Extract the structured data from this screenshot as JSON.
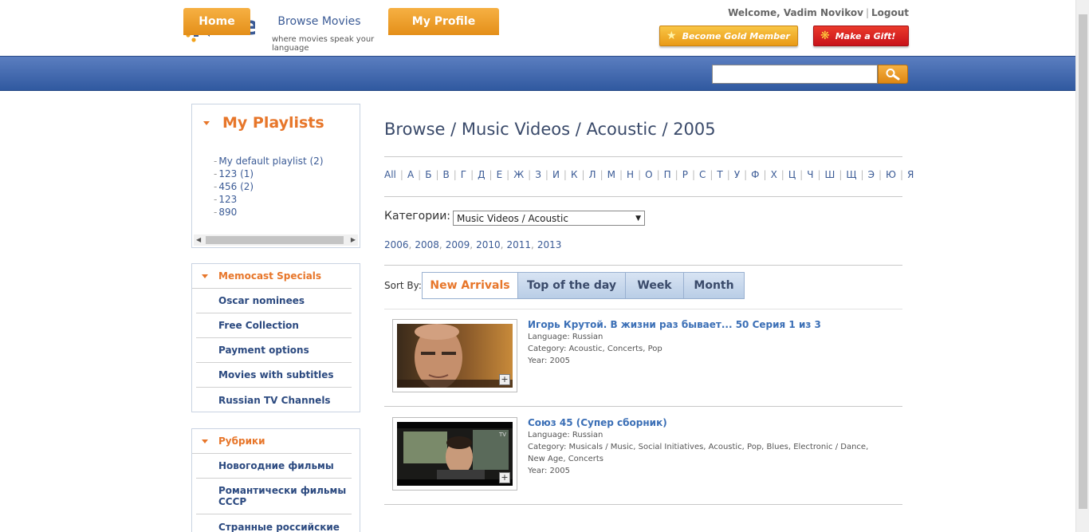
{
  "header": {
    "logo_text": "memocast",
    "tagline": "where movies speak your language",
    "welcome_text": "Welcome, Vadim Novikov",
    "logout_label": "Logout",
    "gold_button": "Become Gold Member",
    "gift_button": "Make a Gift!",
    "languages": [
      "russian-flag",
      "uk-flag"
    ]
  },
  "nav": {
    "tabs": [
      {
        "label": "Home"
      },
      {
        "label": "Browse Movies",
        "active": true
      },
      {
        "label": "My Profile"
      }
    ],
    "search": {
      "value": "",
      "placeholder": ""
    }
  },
  "sidebar": {
    "playlists": {
      "title": "My Playlists",
      "items": [
        "My default playlist (2)",
        "123 (1)",
        "456 (2)",
        "123",
        "890"
      ]
    },
    "specials": {
      "title": "Memocast Specials",
      "items": [
        "Oscar nominees",
        "Free Collection",
        "Payment options",
        "Movies with subtitles",
        "Russian TV Channels"
      ]
    },
    "rubriki": {
      "title": "Рубрики",
      "items": [
        "Новогодние фильмы",
        "Романтически фильмы СССР",
        "Странные российские"
      ]
    }
  },
  "main": {
    "breadcrumb": "Browse / Music Videos / Acoustic / 2005",
    "alphabet": [
      "All",
      "А",
      "Б",
      "В",
      "Г",
      "Д",
      "Е",
      "Ж",
      "З",
      "И",
      "К",
      "Л",
      "М",
      "Н",
      "О",
      "П",
      "Р",
      "С",
      "Т",
      "У",
      "Ф",
      "Х",
      "Ц",
      "Ч",
      "Ш",
      "Щ",
      "Э",
      "Ю",
      "Я"
    ],
    "category_label": "Категории:",
    "category_selected": "Music Videos / Acoustic",
    "years": [
      "2006",
      "2008",
      "2009",
      "2010",
      "2011",
      "2013"
    ],
    "sort_label": "Sort By:",
    "sort_tabs": [
      "New Arrivals",
      "Top of the day",
      "Week",
      "Month"
    ],
    "movies": [
      {
        "title": "Игорь Крутой. В жизни раз бывает... 50 Серия 1 из 3",
        "language": "Language: Russian",
        "category": "Category: Acoustic, Concerts, Pop",
        "year": "Year: 2005"
      },
      {
        "title": "Союз 45 (Супер сборник)",
        "language": "Language: Russian",
        "category": "Category: Musicals / Music, Social Initiatives, Acoustic, Pop, Blues, Electronic / Dance, New Age, Concerts",
        "year": "Year: 2005"
      }
    ]
  },
  "colors": {
    "accent_orange": "#e7762a",
    "nav_blue": "#3b5b96",
    "link_blue": "#3b6fb6"
  }
}
